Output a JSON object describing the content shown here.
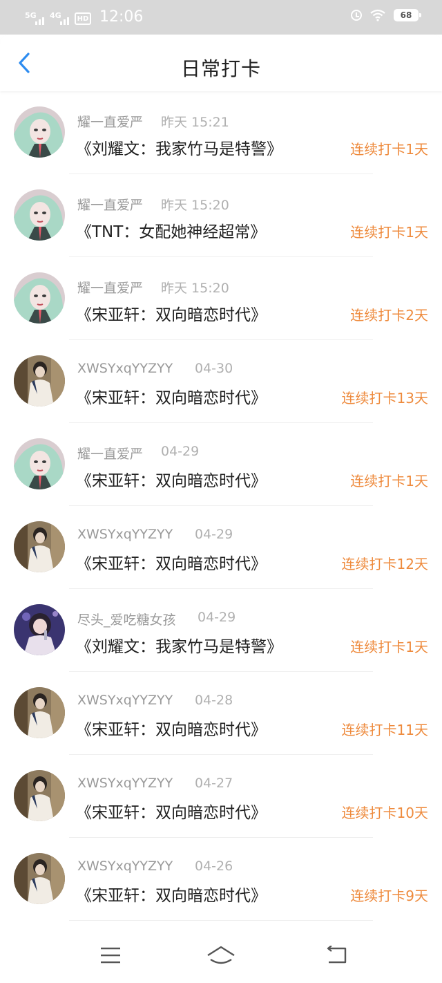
{
  "status_bar": {
    "signal1": "5G",
    "signal2": "4G",
    "hd_label": "HD",
    "time": "12:06",
    "battery": "68",
    "icons": [
      "signal-icon",
      "hd-icon",
      "alarm-icon",
      "wifi-icon",
      "battery-icon"
    ]
  },
  "header": {
    "title": "日常打卡",
    "back_icon": "chevron-left-icon"
  },
  "colors": {
    "accent": "#2d8cf0",
    "streak": "#ee8a3c",
    "name_gray": "#9a9a9a",
    "status_bg": "#d8d8d8"
  },
  "checkins": [
    {
      "user": "耀一直爱严",
      "time": "昨天 15:21",
      "book": "《刘耀文：我家竹马是特警》",
      "streak": "连续打卡1天",
      "avatar": "avatar-1"
    },
    {
      "user": "耀一直爱严",
      "time": "昨天 15:20",
      "book": "《TNT：女配她神经超常》",
      "streak": "连续打卡1天",
      "avatar": "avatar-1"
    },
    {
      "user": "耀一直爱严",
      "time": "昨天 15:20",
      "book": "《宋亚轩：双向暗恋时代》",
      "streak": "连续打卡2天",
      "avatar": "avatar-1"
    },
    {
      "user": "XWSYxqYYZYY",
      "time": "04-30",
      "book": "《宋亚轩：双向暗恋时代》",
      "streak": "连续打卡13天",
      "avatar": "avatar-2"
    },
    {
      "user": "耀一直爱严",
      "time": "04-29",
      "book": "《宋亚轩：双向暗恋时代》",
      "streak": "连续打卡1天",
      "avatar": "avatar-1"
    },
    {
      "user": "XWSYxqYYZYY",
      "time": "04-29",
      "book": "《宋亚轩：双向暗恋时代》",
      "streak": "连续打卡12天",
      "avatar": "avatar-2"
    },
    {
      "user": "尽头_爱吃糖女孩",
      "time": "04-29",
      "book": "《刘耀文：我家竹马是特警》",
      "streak": "连续打卡1天",
      "avatar": "avatar-3"
    },
    {
      "user": "XWSYxqYYZYY",
      "time": "04-28",
      "book": "《宋亚轩：双向暗恋时代》",
      "streak": "连续打卡11天",
      "avatar": "avatar-2"
    },
    {
      "user": "XWSYxqYYZYY",
      "time": "04-27",
      "book": "《宋亚轩：双向暗恋时代》",
      "streak": "连续打卡10天",
      "avatar": "avatar-2"
    },
    {
      "user": "XWSYxqYYZYY",
      "time": "04-26",
      "book": "《宋亚轩：双向暗恋时代》",
      "streak": "连续打卡9天",
      "avatar": "avatar-2"
    }
  ],
  "nav": {
    "icons": [
      "menu-icon",
      "home-icon",
      "back-icon"
    ]
  }
}
